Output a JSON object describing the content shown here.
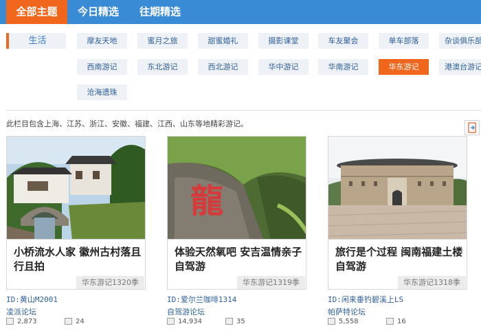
{
  "nav": {
    "tabs": [
      {
        "label": "全部主题",
        "active": true
      },
      {
        "label": "今日精选",
        "active": false
      },
      {
        "label": "往期精选",
        "active": false
      }
    ]
  },
  "category": {
    "label": "生活",
    "tags": [
      "摩友天地",
      "蜜月之旅",
      "甜蜜婚礼",
      "摄影课堂",
      "车友聚会",
      "单车部落",
      "杂谈俱乐部",
      "西南游记",
      "东北游记",
      "西北游记",
      "华中游记",
      "华南游记",
      "华东游记",
      "港澳台游记",
      "沧海遗珠"
    ],
    "active_tag": "华东游记"
  },
  "description": "此栏目包含上海、江苏、浙江、安徽、福建、江西、山东等地精彩游记。",
  "cards": [
    {
      "title": "小桥流水人家 徽州古村落且行且拍",
      "badge": "华东游记1320季",
      "uid": "ID:黄山M2001",
      "forum": "凌派论坛",
      "views": "2,873",
      "comments": "24"
    },
    {
      "title": "体验天然氧吧 安吉温情亲子自驾游",
      "badge": "华东游记1319季",
      "uid": "ID:爱尔兰咖啡1314",
      "forum": "自驾游论坛",
      "views": "14,934",
      "comments": "35"
    },
    {
      "title": "旅行是个过程 闽南福建土楼自驾游",
      "badge": "华东游记1318季",
      "uid": "ID:闲来垂钓碧溪上LS",
      "forum": "帕萨特论坛",
      "views": "5,558",
      "comments": "16"
    }
  ],
  "colors": {
    "nav_bg": "#3a8bd6",
    "accent": "#f0661c",
    "link": "#2d5f9a"
  }
}
